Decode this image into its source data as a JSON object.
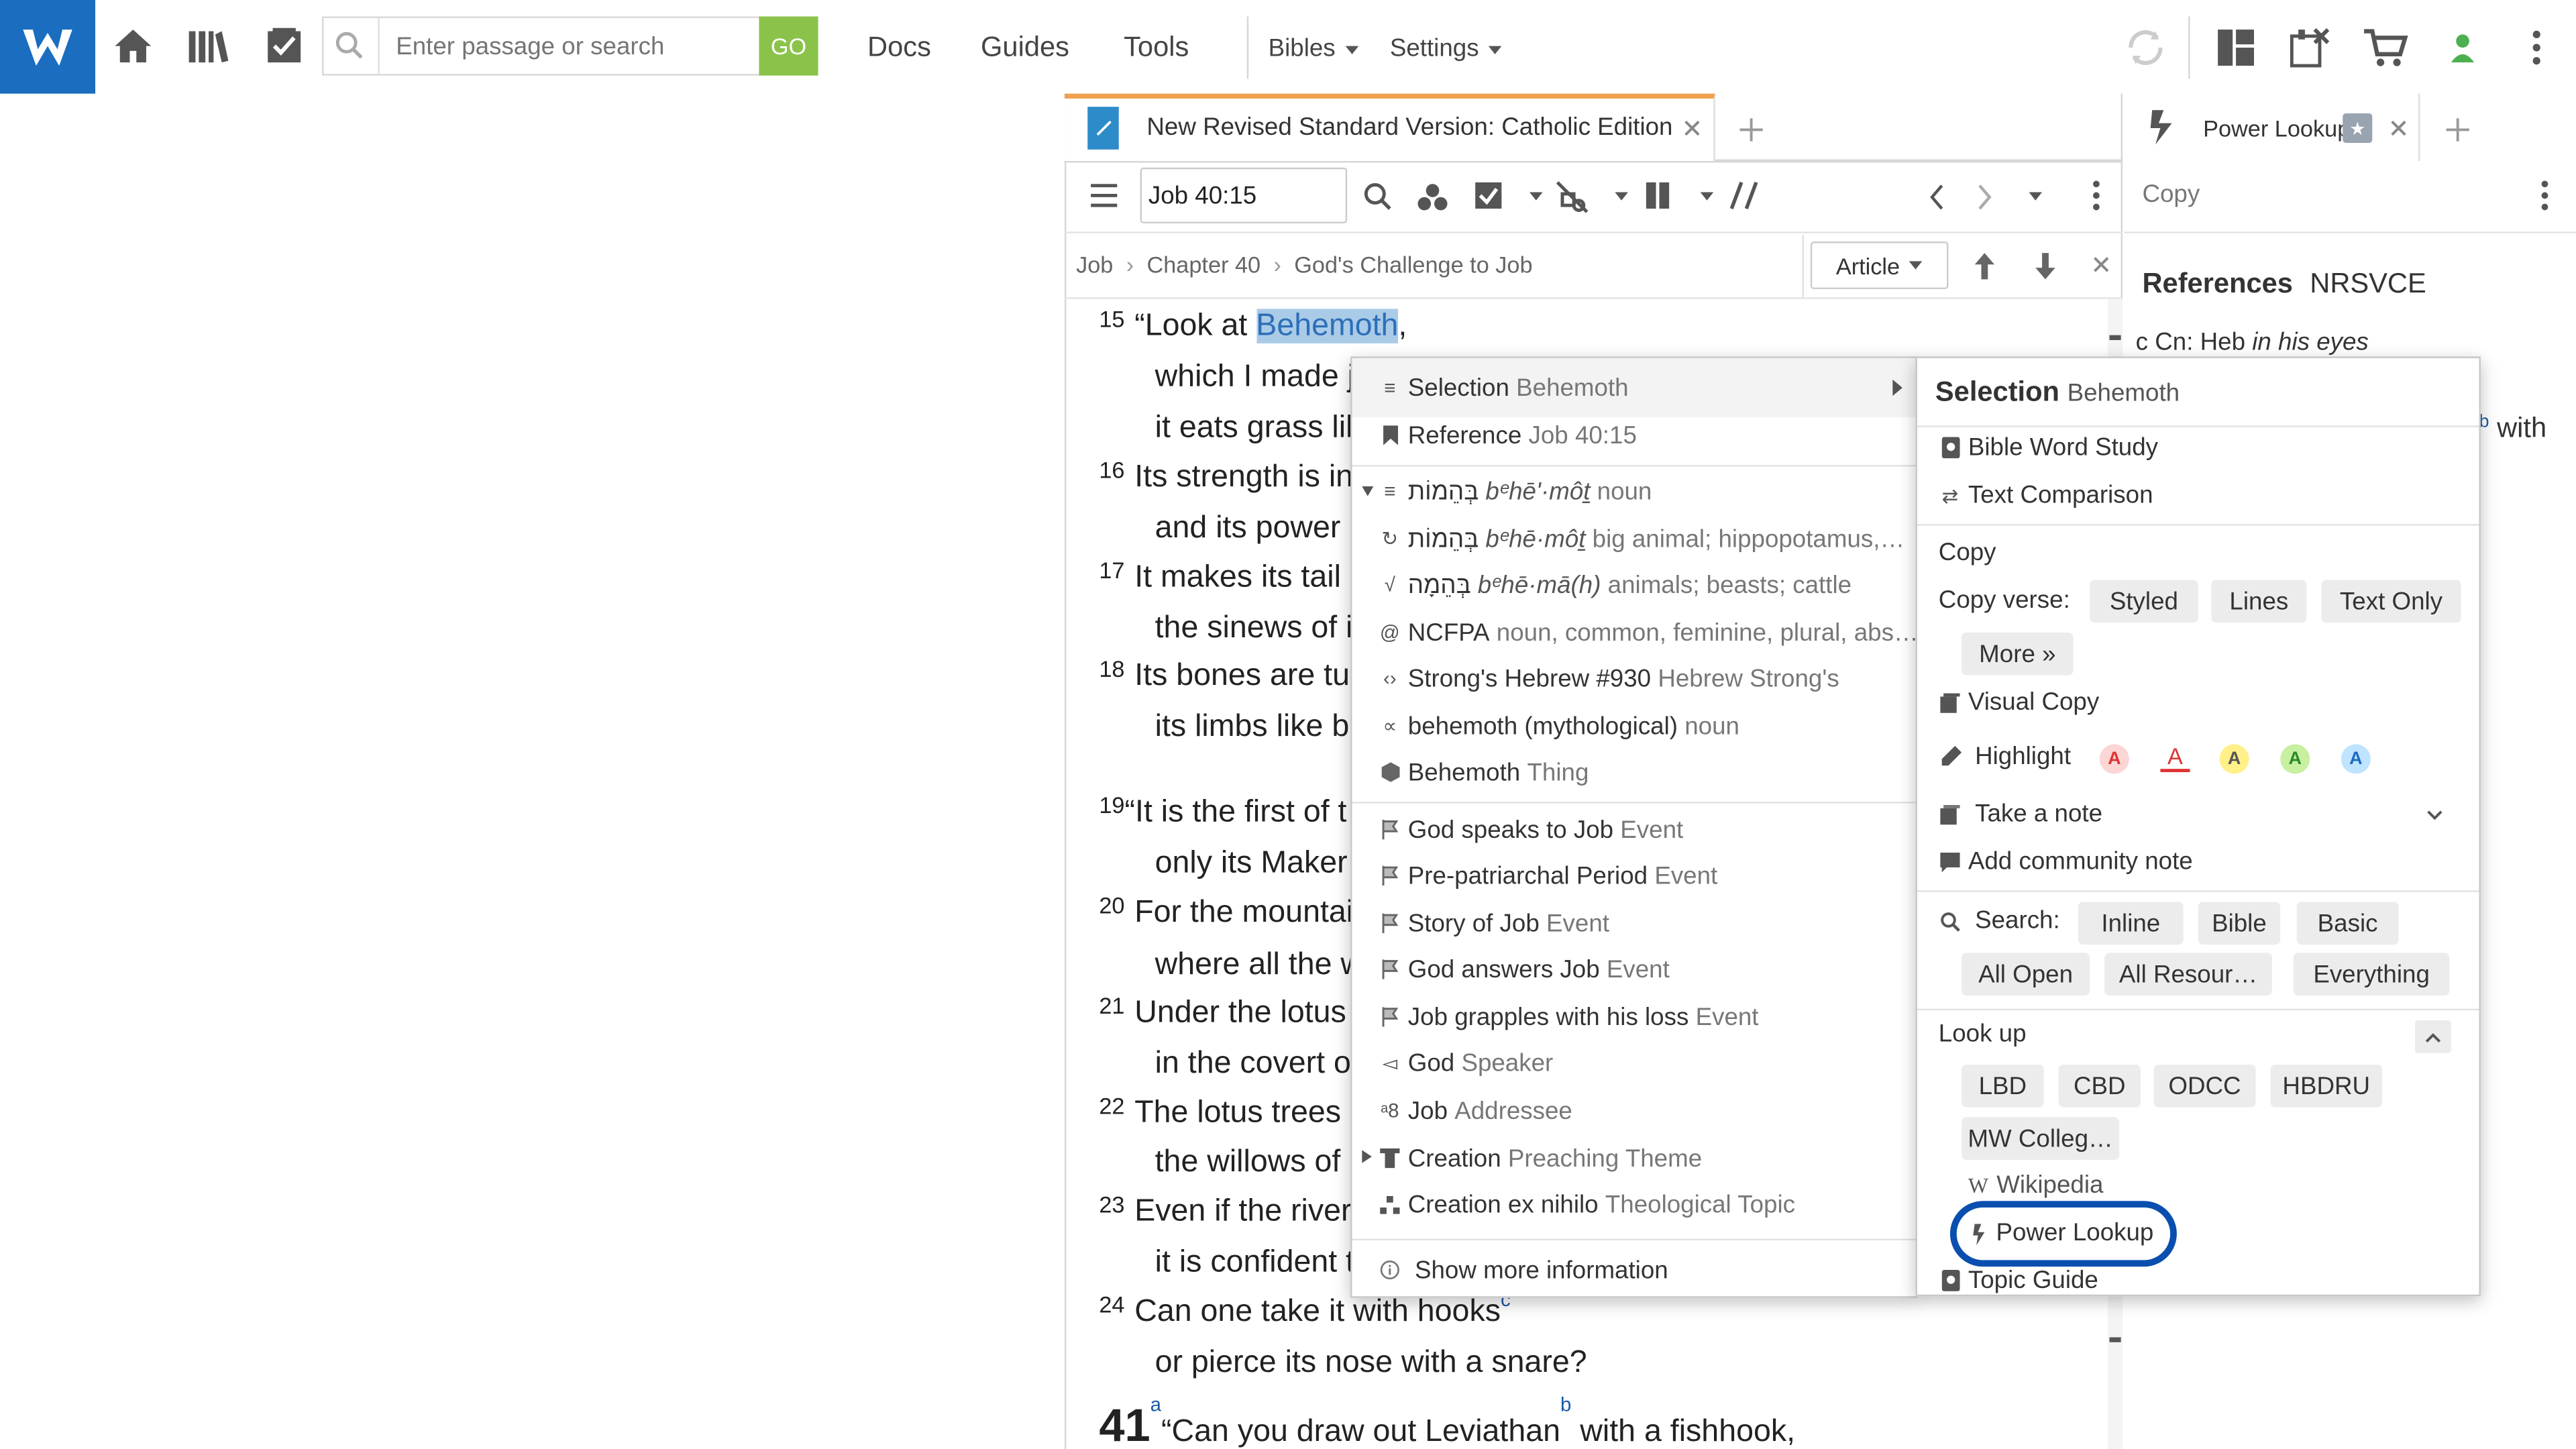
{
  "topbar": {
    "search_placeholder": "Enter passage or search",
    "go_label": "GO",
    "nav": [
      "Docs",
      "Guides",
      "Tools"
    ],
    "bibles_label": "Bibles",
    "settings_label": "Settings"
  },
  "bible_panel": {
    "tab_title": "New Revised Standard Version: Catholic Edition",
    "reference": "Job 40:15",
    "breadcrumb": [
      "Job",
      "Chapter 40",
      "God's Challenge to Job"
    ],
    "article_label": "Article",
    "verses": {
      "v15_num": "15",
      "v15_a": "“Look at ",
      "v15_hl": "Behemoth",
      "v15_b": ",",
      "l2": "which I made j",
      "l3": "it eats grass lik",
      "v16_num": "16",
      "v16": "Its strength is in",
      "l5": "and its power i",
      "v17_num": "17",
      "v17": "It makes its tail s",
      "l7": "the sinews of i",
      "v18_num": "18",
      "v18": "Its bones are tul",
      "l9": "its limbs like b",
      "v19_num": "19",
      "v19": "“It is the first of t",
      "l11": "only its Maker",
      "v20_num": "20",
      "v20": "For the mountai",
      "l13": "where all the w",
      "v21_num": "21",
      "v21": "Under the lotus",
      "l15": "in the covert o",
      "v22_num": "22",
      "v22": "The lotus trees c",
      "l17": "the willows of",
      "v23_num": "23",
      "v23": "Even if the river",
      "l19": "it is confident t",
      "v24_num": "24",
      "v24": "Can one take it with hooks",
      "v24_fn": "c",
      "l21": "or pierce its nose with a snare?",
      "ch41": "41",
      "ch41_fn_a": "a",
      "ch41_text": "“Can you draw out Leviathan",
      "ch41_fn_b": "b",
      "ch41_tail": " with a fishhook,"
    }
  },
  "power_panel": {
    "tab_title": "Power Lookup",
    "copy_label": "Copy",
    "references_label": "References",
    "version_label": "NRSVCE",
    "footnote_c": "c Cn: Heb ",
    "footnote_c_it": "in his eyes",
    "footnote_b_mark": "b",
    "footnote_b_text": "with"
  },
  "context_menu": {
    "selection_label": "Selection",
    "selection_word": "Behemoth",
    "reference_label": "Reference",
    "reference_value": "Job 40:15",
    "items": [
      {
        "h": "בְּהֵמוֹת",
        "t": "bᵉhēʹ·môṯ",
        "g": "noun"
      },
      {
        "h": "בְּהֵמוֹת",
        "t": "bᵉhē·môṯ",
        "g": "big animal; hippopotamus,…"
      },
      {
        "h": "בְּהֵמָה",
        "t": "bᵉhē·mā(h)",
        "g": "animals; beasts; cattle"
      }
    ],
    "morph": "NCFPA",
    "morph_desc": "noun, common, feminine, plural, abs…",
    "strongs": "Strong's Hebrew #930",
    "strongs_src": "Hebrew Strong's",
    "sense": "behemoth (mythological)",
    "sense_type": "noun",
    "thing": "Behemoth",
    "thing_type": "Thing",
    "events": [
      {
        "name": "God speaks to Job",
        "type": "Event"
      },
      {
        "name": "Pre-patriarchal Period",
        "type": "Event"
      },
      {
        "name": "Story of Job",
        "type": "Event"
      },
      {
        "name": "God answers Job",
        "type": "Event"
      },
      {
        "name": "Job grapples with his loss",
        "type": "Event"
      }
    ],
    "speaker": "God",
    "speaker_type": "Speaker",
    "addressee": "Job",
    "addressee_type": "Addressee",
    "theme": "Creation",
    "theme_type": "Preaching Theme",
    "topic": "Creation ex nihilo",
    "topic_type": "Theological Topic",
    "more": "Show more information"
  },
  "actions_menu": {
    "header_label": "Selection",
    "header_word": "Behemoth",
    "bible_word_study": "Bible Word Study",
    "text_comparison": "Text Comparison",
    "copy": "Copy",
    "copy_verse": "Copy verse:",
    "copy_styled": "Styled",
    "copy_lines": "Lines",
    "copy_text_only": "Text Only",
    "copy_more": "More »",
    "visual_copy": "Visual Copy",
    "highlight": "Highlight",
    "highlight_letter": "A",
    "take_note": "Take a note",
    "community_note": "Add community note",
    "search_label": "Search:",
    "search_opts": [
      "Inline",
      "Bible",
      "Basic",
      "All Open",
      "All Resour…",
      "Everything"
    ],
    "lookup_label": "Look up",
    "lookup_opts": [
      "LBD",
      "CBD",
      "ODCC",
      "HBDRU",
      "MW Colleg…"
    ],
    "wikipedia": "Wikipedia",
    "power_lookup": "Power Lookup",
    "topic_guide": "Topic Guide"
  },
  "colors": {
    "accent": "#1a6dbf",
    "go": "#8bc34a",
    "tab_accent": "#f0a050",
    "ring": "#0a4fb0",
    "highlight": "#aacbe8"
  }
}
